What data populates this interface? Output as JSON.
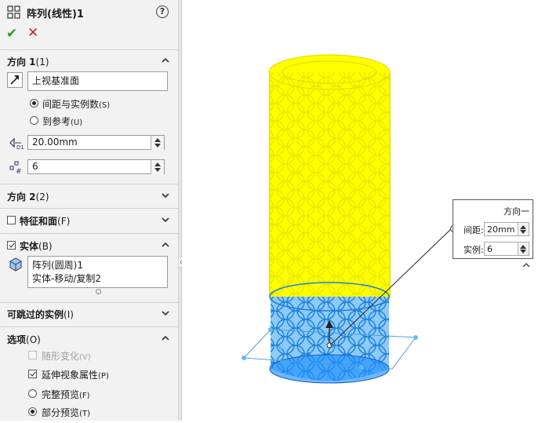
{
  "header": {
    "title": "阵列(线性)1",
    "help_label": "?"
  },
  "actions": {
    "ok_label": "✔",
    "cancel_label": "✕"
  },
  "direction1": {
    "title": "方向 1",
    "accel": "(1)",
    "reference": "上视基准面",
    "options": [
      {
        "label": "间距与实例数",
        "accel": "(S)",
        "selected": true
      },
      {
        "label": "到参考",
        "accel": "(U)",
        "selected": false
      }
    ],
    "spacing": "20.00mm",
    "count": "6"
  },
  "direction2": {
    "title": "方向 2",
    "accel": "(2)"
  },
  "features_faces": {
    "title": "特征和面",
    "accel": "(F)",
    "checked": false
  },
  "bodies": {
    "title": "实体",
    "accel": "(B)",
    "checked": true,
    "items": [
      "阵列(圆周)1",
      "实体-移动/复制2"
    ]
  },
  "skip_instances": {
    "title": "可跳过的实例",
    "accel": "(I)"
  },
  "options": {
    "title": "选项",
    "accel": "(O)",
    "vary_sketch": {
      "label": "随形变化",
      "accel": "(V)",
      "checked": false,
      "disabled": true
    },
    "propagate_visual": {
      "label": "延伸视象属性",
      "accel": "(P)",
      "checked": true
    },
    "full_preview": {
      "label": "完整预览",
      "accel": "(F)",
      "selected": false
    },
    "partial_preview": {
      "label": "部分预览",
      "accel": "(T)",
      "selected": true
    }
  },
  "callout": {
    "title": "方向一",
    "spacing_label": "间距:",
    "spacing_value": "20mm",
    "count_label": "实例:",
    "count_value": "6"
  },
  "colors": {
    "pattern_yellow": "#ffff00",
    "body_blue": "#3fa0f0",
    "ok_green": "#2c9a2c",
    "cancel_red": "#d02020"
  }
}
